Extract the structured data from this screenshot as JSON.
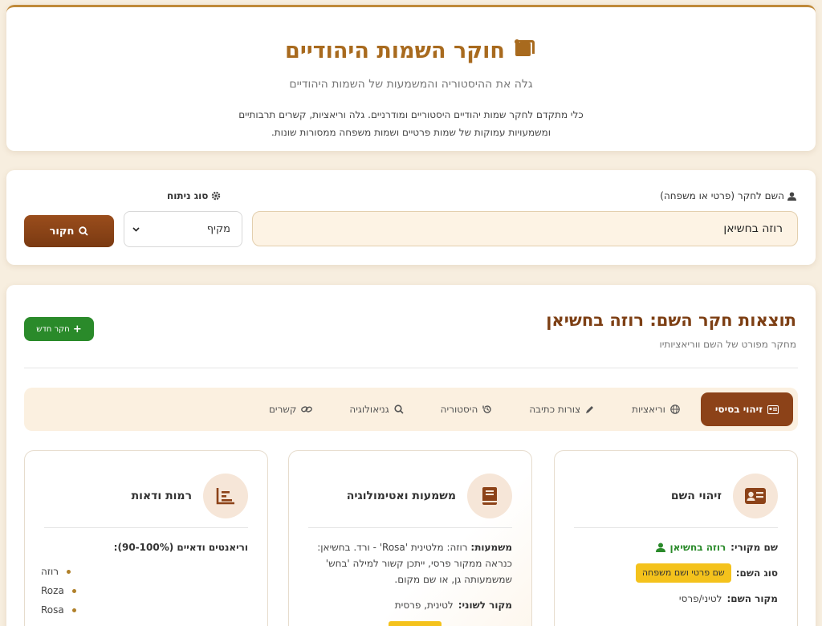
{
  "header": {
    "title": "חוקר השמות היהודיים",
    "subtitle": "גלה את ההיסטוריה והמשמעות של השמות היהודיים",
    "desc_line1": "כלי מתקדם לחקר שמות יהודיים היסטוריים ומודרניים. גלה וריאציות, קשרים תרבותיים",
    "desc_line2": "ומשמעויות עמוקות של שמות פרטיים ושמות משפחה ממסורות שונות."
  },
  "search": {
    "name_label": "השם לחקר (פרטי או משפחה)",
    "name_value": "רוזה בחשיאן",
    "type_label": "סוג ניתוח",
    "type_value": "מקיף",
    "submit_label": "חקור"
  },
  "results": {
    "title": "תוצאות חקר השם: רוזה בחשיאן",
    "subtitle": "מחקר מפורט של השם ווריאציותיו",
    "new_label": "חקר חדש",
    "tabs": [
      {
        "label": "זיהוי בסיסי"
      },
      {
        "label": "וריאציות"
      },
      {
        "label": "צורות כתיבה"
      },
      {
        "label": "היסטוריה"
      },
      {
        "label": "גניאולוגיה"
      },
      {
        "label": "קשרים"
      }
    ]
  },
  "panels": {
    "identity": {
      "title": "זיהוי השם",
      "orig_key": "שם מקורי:",
      "orig_val": "רוזה בחשיאן",
      "type_key": "סוג השם:",
      "type_val": "שם פרטי ושם משפחה",
      "source_key": "מקור השם:",
      "source_val": "לטיני/פרסי"
    },
    "meaning": {
      "title": "משמעות ואטימולוגיה",
      "meaning_key": "משמעות:",
      "meaning_text": "רוזה: מלטינית 'Rosa' - ורד. בחשיאן: כנראה ממקור פרסי, ייתכן קשור למילה 'בחש' שמשמעותה גן, או שם מקום.",
      "lang_key": "מקור לשוני:",
      "lang_val": "לטינית, פרסית"
    },
    "confidence": {
      "title": "רמות ודאות",
      "heading": "וריאנטים ודאיים (90-100%):",
      "items": [
        "רוזה",
        "Roza",
        "Rosa"
      ]
    }
  }
}
